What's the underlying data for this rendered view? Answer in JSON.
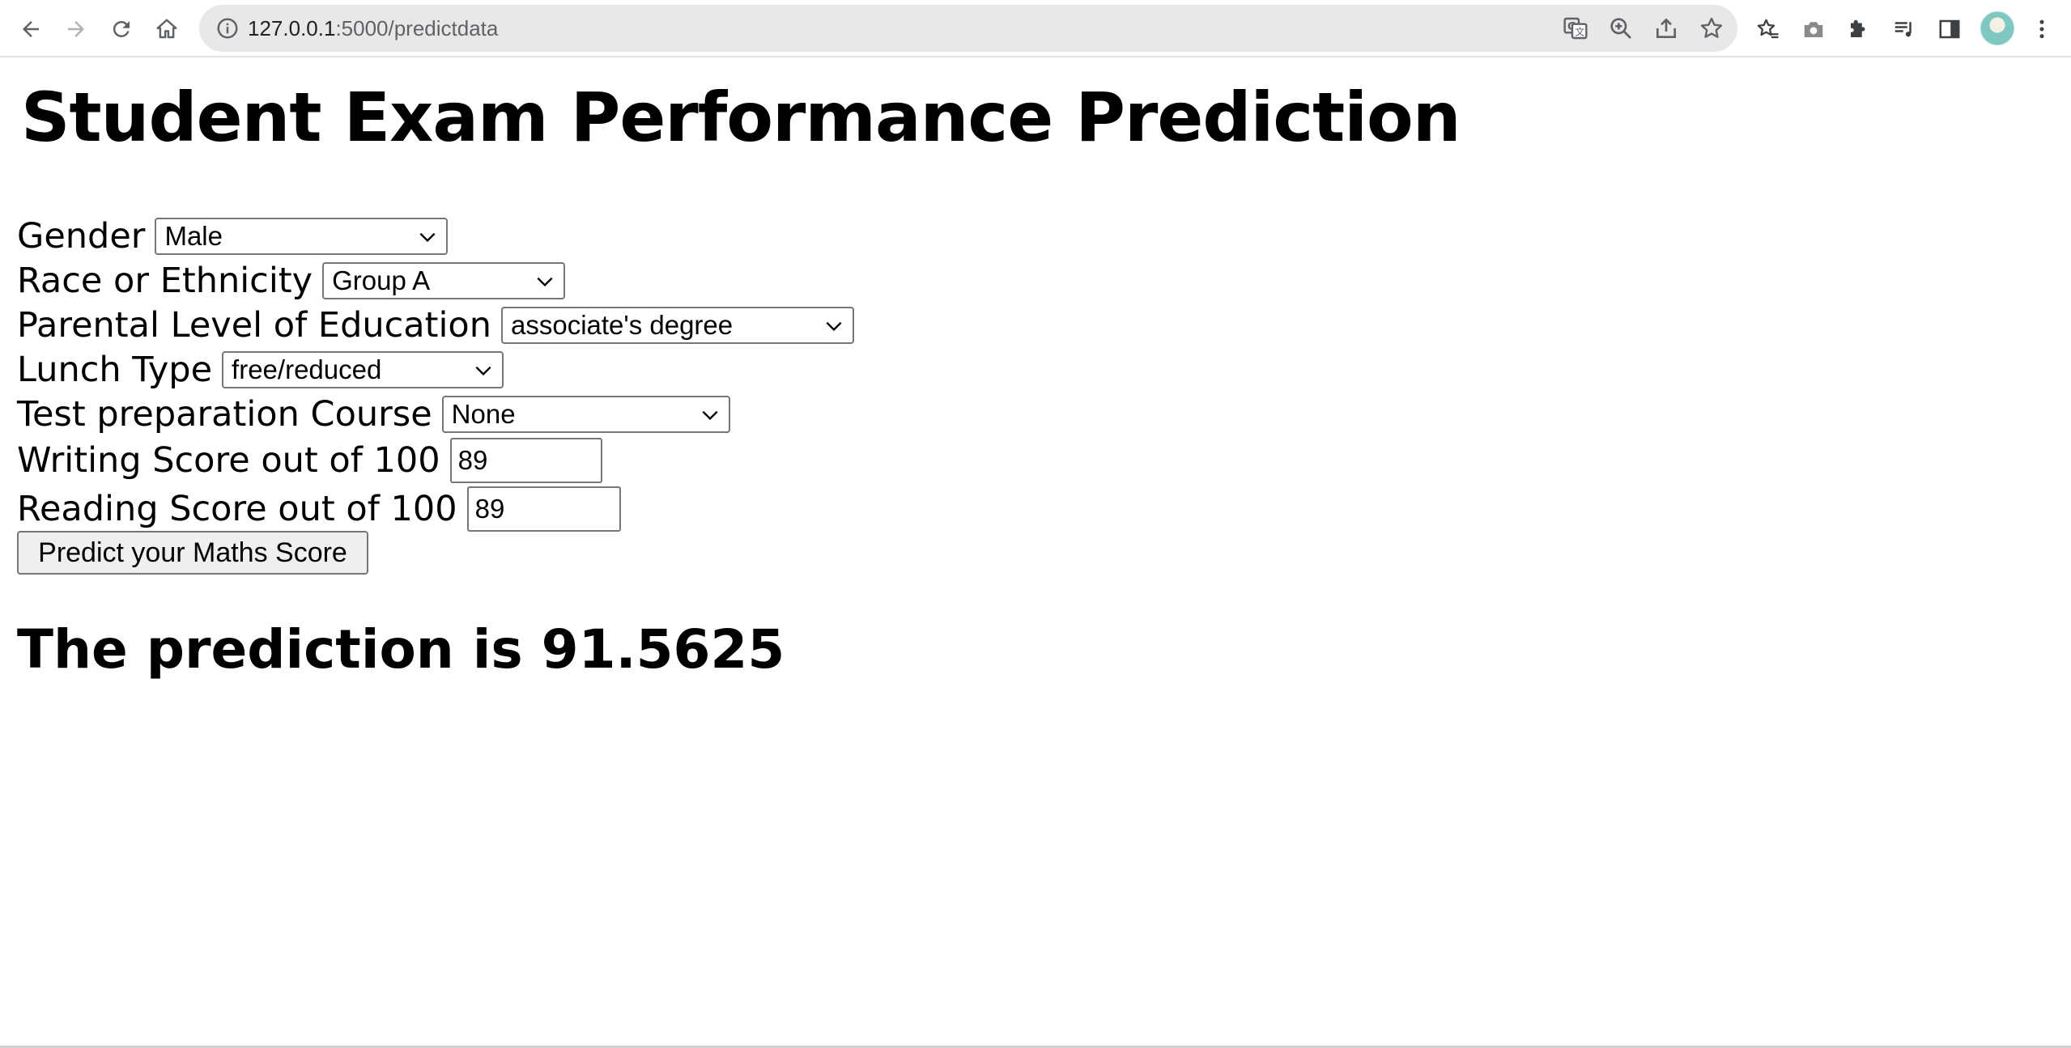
{
  "browser": {
    "url_host": "127.0.0.1",
    "url_path": ":5000/predictdata",
    "icons": [
      "back-icon",
      "forward-icon",
      "reload-icon",
      "home-icon",
      "site-info-icon",
      "translate-icon",
      "zoom-icon",
      "share-icon",
      "bookmark-star-icon",
      "reading-list-icon",
      "camera-icon",
      "extensions-icon",
      "media-control-icon",
      "side-panel-icon",
      "profile-avatar",
      "menu-icon"
    ]
  },
  "page": {
    "title": "Student Exam Performance Prediction",
    "fields": {
      "gender": {
        "label": "Gender",
        "value": "Male"
      },
      "ethnicity": {
        "label": "Race or Ethnicity",
        "value": "Group A"
      },
      "parental_education": {
        "label": "Parental Level of Education",
        "value": "associate's degree"
      },
      "lunch": {
        "label": "Lunch Type",
        "value": "free/reduced"
      },
      "test_prep": {
        "label": "Test preparation Course",
        "value": "None"
      },
      "writing_score": {
        "label": "Writing Score out of 100",
        "value": "89"
      },
      "reading_score": {
        "label": "Reading Score out of 100",
        "value": "89"
      }
    },
    "submit_label": "Predict your Maths Score",
    "result": "The prediction is 91.5625"
  },
  "colors": {
    "field_border": "#767676",
    "button_bg": "#efefef",
    "omnibox_bg": "#e8e8e8"
  }
}
